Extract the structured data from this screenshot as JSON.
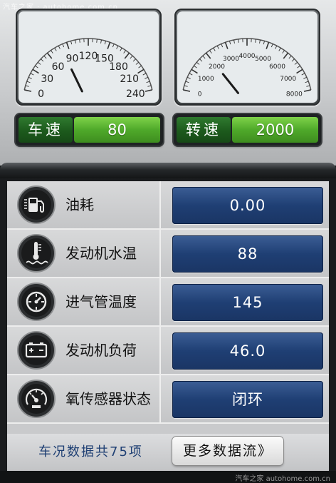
{
  "watermark": "汽车之家 · autohome.com.cn",
  "speed_gauge": {
    "ticks": [
      "0",
      "30",
      "60",
      "90",
      "120",
      "150",
      "180",
      "210",
      "240"
    ],
    "max": 240,
    "needle_value": 80
  },
  "rpm_gauge": {
    "ticks": [
      "0",
      "1000",
      "2000",
      "3000",
      "4000",
      "5000",
      "6000",
      "7000",
      "8000"
    ],
    "max": 8000,
    "needle_value": 2000
  },
  "readouts": {
    "speed": {
      "label": "车速",
      "value": "80"
    },
    "rpm": {
      "label": "转速",
      "value": "2000"
    }
  },
  "rows": [
    {
      "name": "油耗",
      "value": "0.00",
      "icon": "fuel-pump-icon"
    },
    {
      "name": "发动机水温",
      "value": "88",
      "icon": "coolant-temperature-icon"
    },
    {
      "name": "进气管温度",
      "value": "145",
      "icon": "intake-temperature-icon"
    },
    {
      "name": "发动机负荷",
      "value": "46.0",
      "icon": "battery-load-icon"
    },
    {
      "name": "氧传感器状态",
      "value": "闭环",
      "icon": "oxygen-sensor-icon"
    }
  ],
  "footer": {
    "summary": "车况数据共75项",
    "more_button": "更多数据流》"
  },
  "bottom_watermark": "汽车之家 autohome.com.cn",
  "colors": {
    "green_value": "#4fa92a",
    "blue_value": "#1f3f74",
    "footer_text": "#1e3f73"
  }
}
